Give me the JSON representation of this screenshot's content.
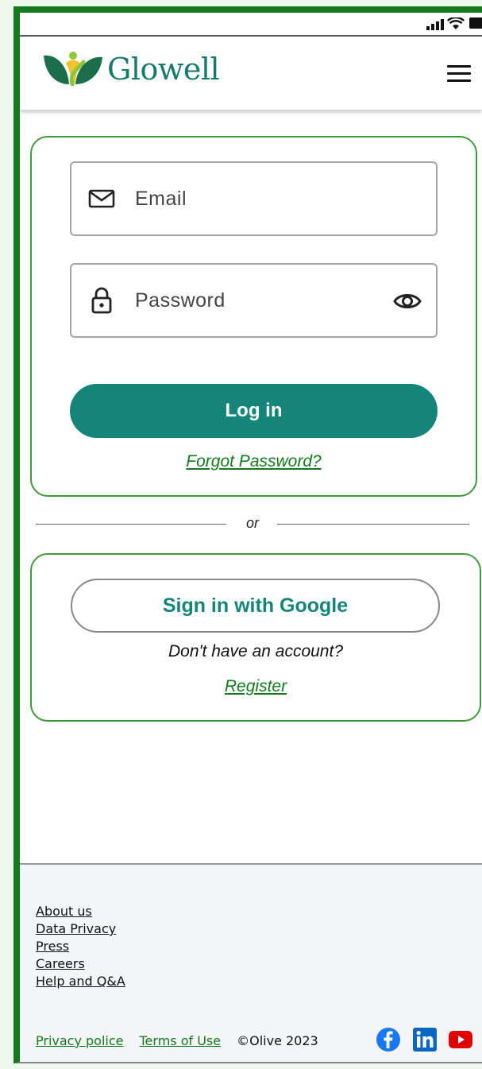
{
  "app": {
    "brand": "Glowell"
  },
  "login": {
    "email_placeholder": "Email",
    "password_placeholder": "Password",
    "login_label": "Log in",
    "forgot_label": "Forgot Password?"
  },
  "divider": {
    "label": "or"
  },
  "signup": {
    "google_label": "Sign in with Google",
    "no_account_text": "Don't have an account?",
    "register_label": "Register"
  },
  "footer": {
    "links": [
      "About us",
      "Data Privacy",
      "Press",
      "Careers",
      "Help and Q&A"
    ],
    "privacy_label": "Privacy police",
    "terms_label": "Terms of Use",
    "copyright": "©Olive 2023",
    "socials": [
      "facebook-icon",
      "linkedin-icon",
      "youtube-icon"
    ]
  },
  "colors": {
    "accent": "#15857a",
    "link_green": "#157a1e",
    "frame_green": "#157a1e",
    "facebook": "#1877f2",
    "linkedin": "#0a66c2",
    "youtube": "#e00000"
  }
}
